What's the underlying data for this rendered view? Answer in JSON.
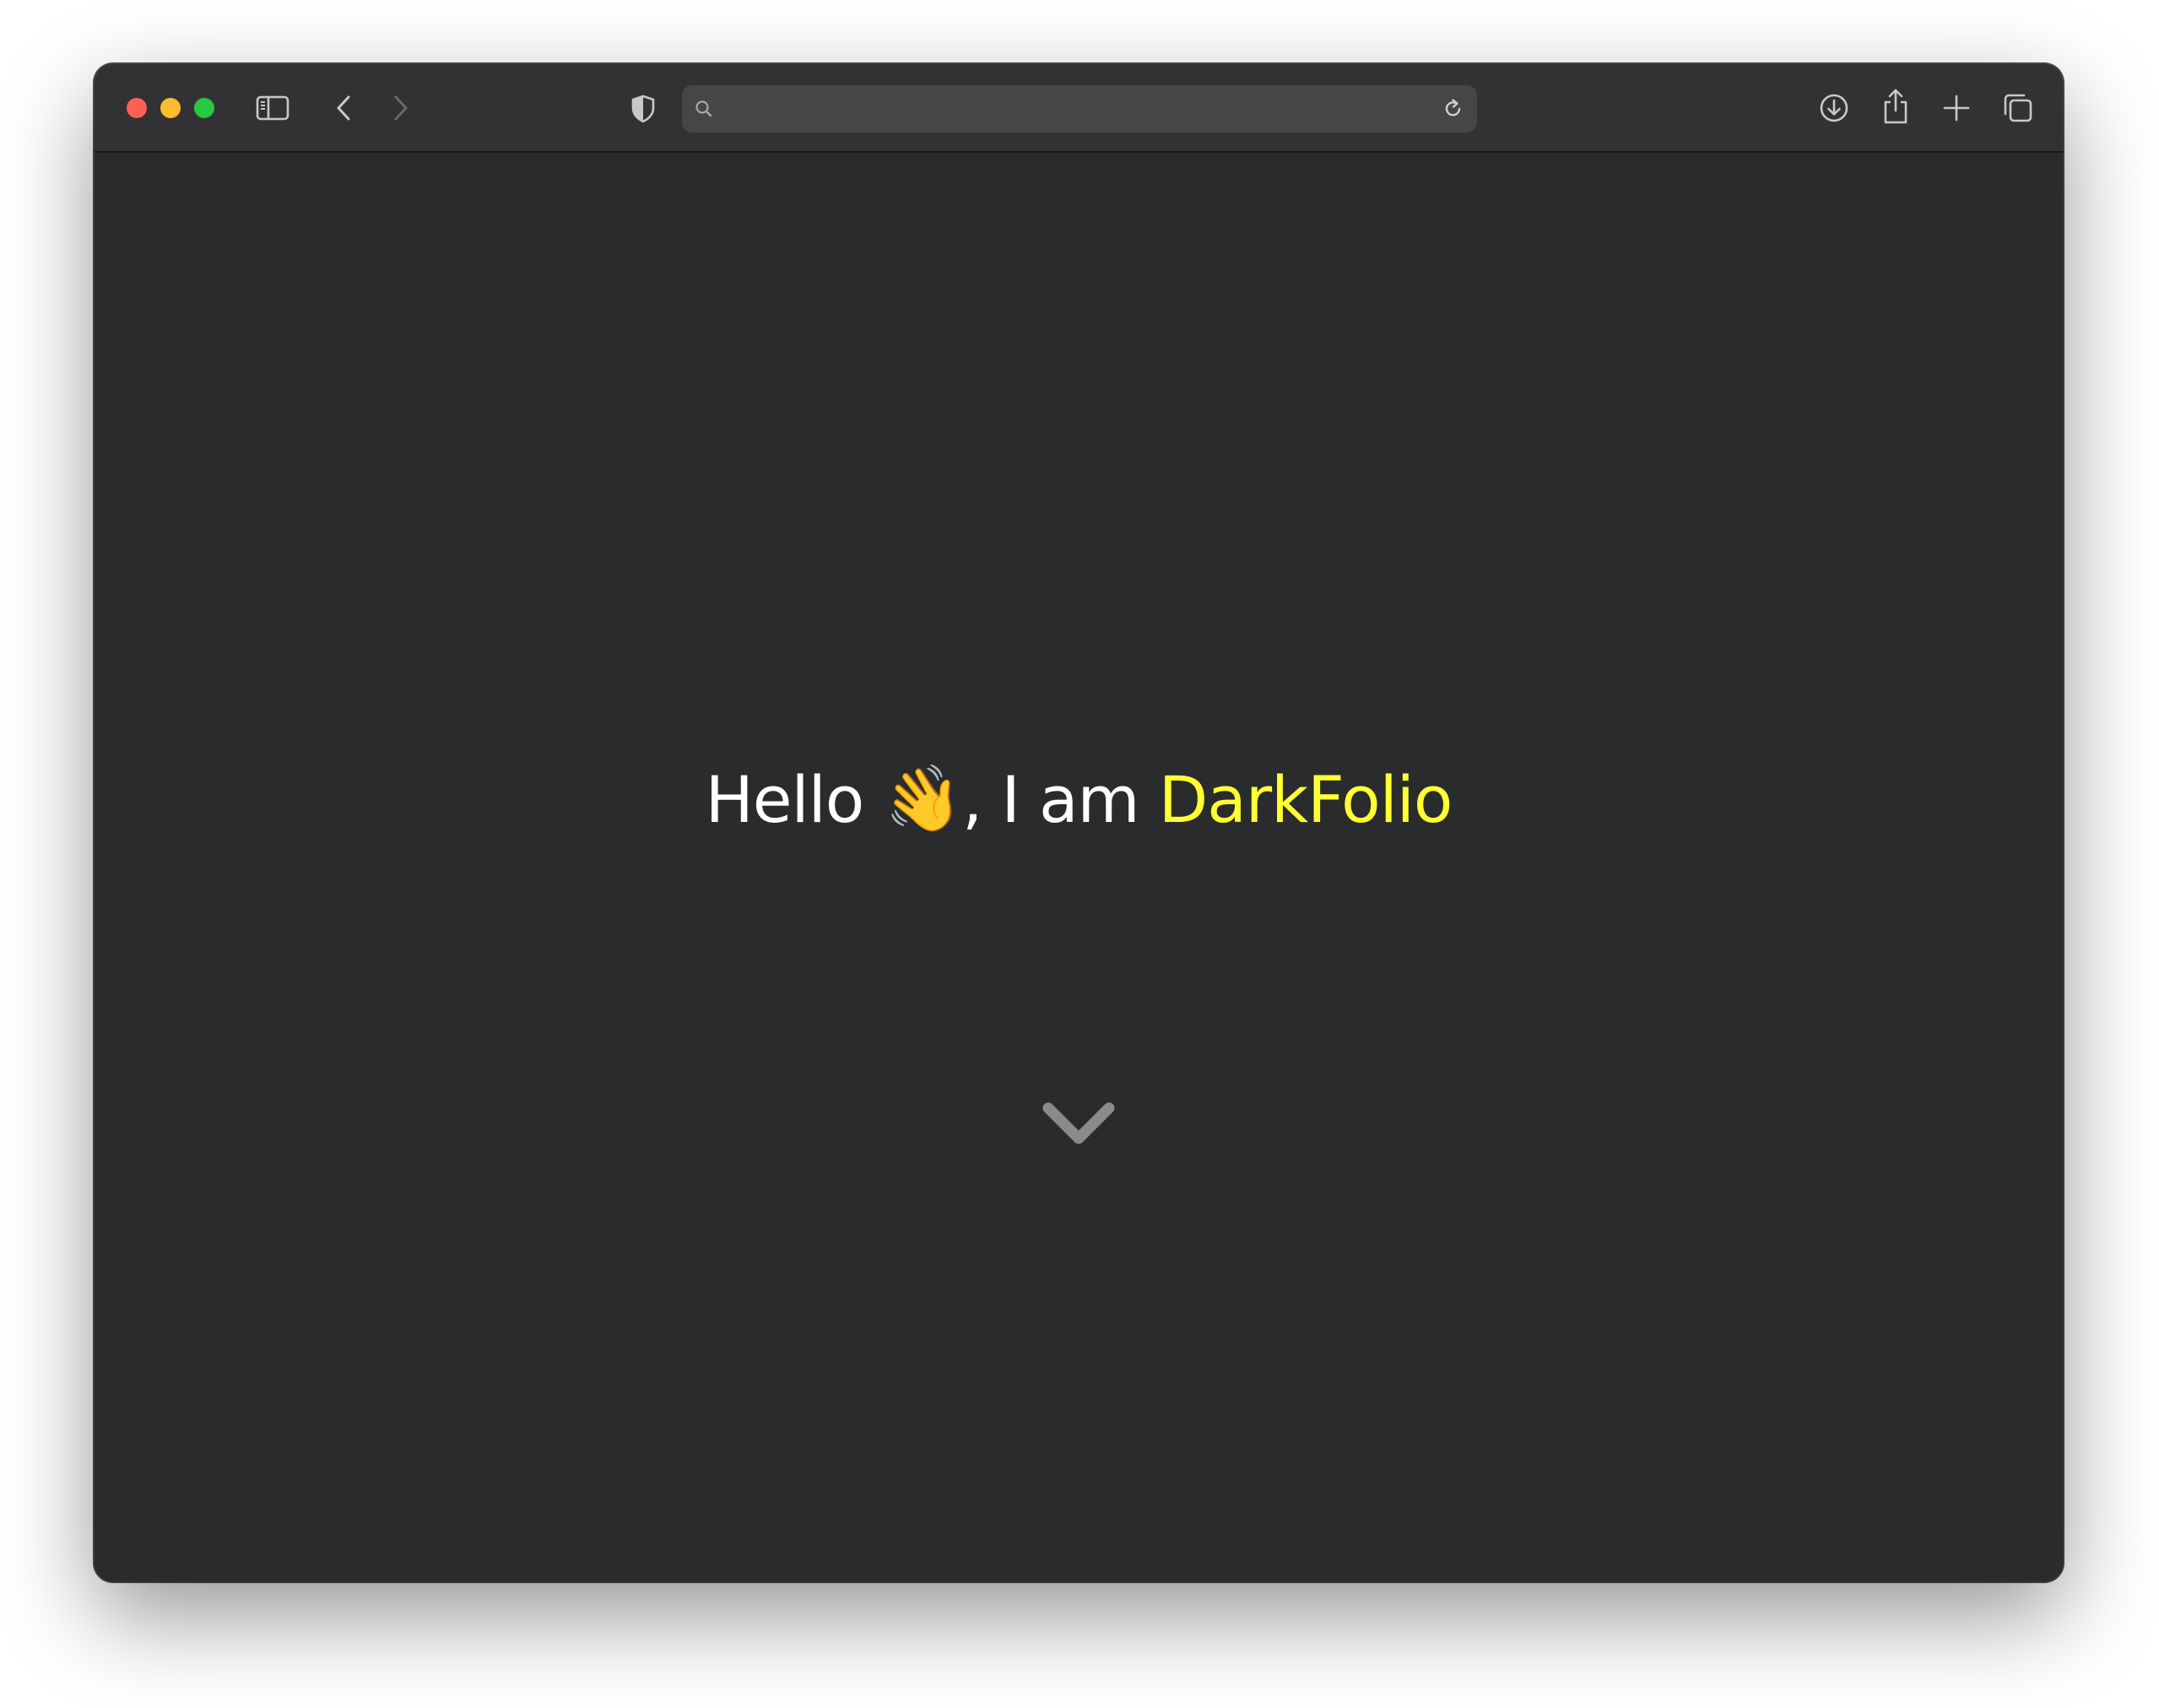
{
  "window": {
    "traffic_lights": [
      {
        "name": "close",
        "color": "#ff5f57"
      },
      {
        "name": "minimize",
        "color": "#febc2e"
      },
      {
        "name": "zoom",
        "color": "#28c840"
      }
    ]
  },
  "toolbar": {
    "icons": {
      "sidebar": "sidebar-icon",
      "back": "chevron-left-icon",
      "forward": "chevron-right-icon",
      "privacy": "shield-icon",
      "search": "search-icon",
      "reload": "reload-icon",
      "downloads": "download-icon",
      "share": "share-icon",
      "new_tab": "plus-icon",
      "tabs": "tab-overview-icon"
    },
    "address_bar": {
      "value": "",
      "placeholder": ""
    }
  },
  "page": {
    "greeting": "Hello",
    "emoji": "👋",
    "intro": ", I am",
    "name": "DarkFolio",
    "scroll_icon": "chevron-down-icon",
    "colors": {
      "background": "#2a2b2d",
      "text": "#ffffff",
      "accent": "#ffff33"
    }
  }
}
